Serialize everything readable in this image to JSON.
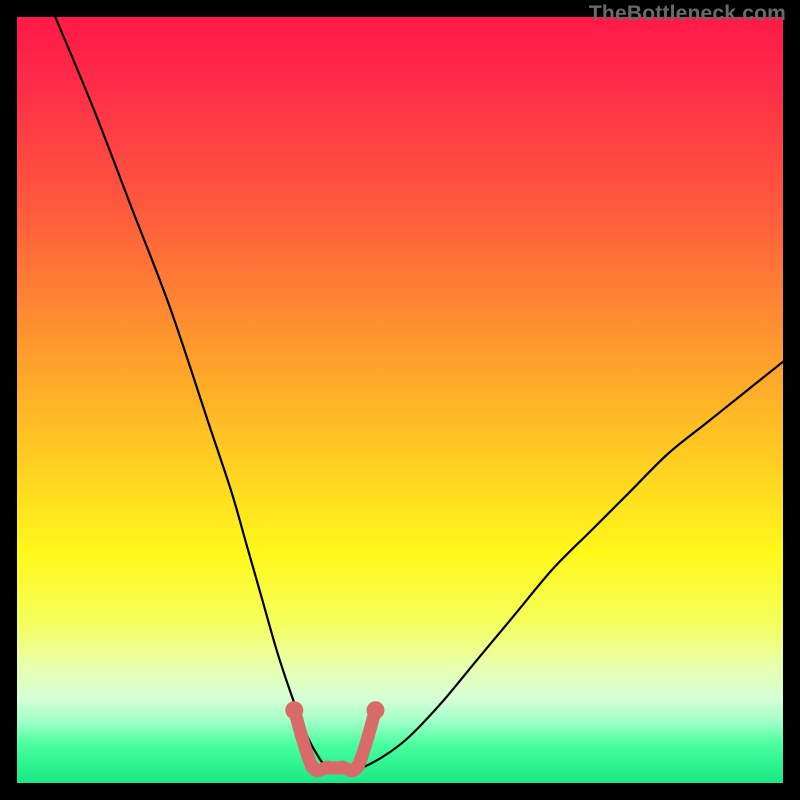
{
  "watermark": "TheBottleneck.com",
  "colors": {
    "background": "#000000",
    "curve": "#000000",
    "highlight_stroke": "#d96a6a",
    "highlight_dot": "#d96a6a",
    "gradient_top": "#ff1a47",
    "gradient_bottom": "#18e884"
  },
  "chart_data": {
    "type": "line",
    "title": "",
    "xlabel": "",
    "ylabel": "",
    "xlim": [
      0,
      100
    ],
    "ylim": [
      0,
      100
    ],
    "grid": false,
    "legend": false,
    "series": [
      {
        "name": "bottleneck-curve",
        "x": [
          5,
          10,
          15,
          20,
          25,
          28,
          30,
          32,
          34,
          36,
          37.5,
          39,
          40.5,
          42,
          45,
          50,
          55,
          60,
          65,
          70,
          75,
          80,
          85,
          90,
          95,
          100
        ],
        "y": [
          100,
          88,
          75,
          62,
          47,
          38,
          31,
          24,
          17,
          11,
          7,
          4,
          2,
          2,
          2,
          5,
          10,
          16,
          22,
          28,
          33,
          38,
          43,
          47,
          51,
          55
        ]
      }
    ],
    "highlight": {
      "name": "recommended-range",
      "x_range": [
        36,
        47
      ],
      "y_level": 2,
      "endpoints": [
        {
          "x": 36.2,
          "y": 9.5
        },
        {
          "x": 46.8,
          "y": 9.5
        }
      ],
      "flat_points": [
        {
          "x": 38.5,
          "y": 2.2
        },
        {
          "x": 40.5,
          "y": 2.0
        },
        {
          "x": 42.5,
          "y": 2.0
        },
        {
          "x": 44.5,
          "y": 2.2
        }
      ]
    }
  }
}
